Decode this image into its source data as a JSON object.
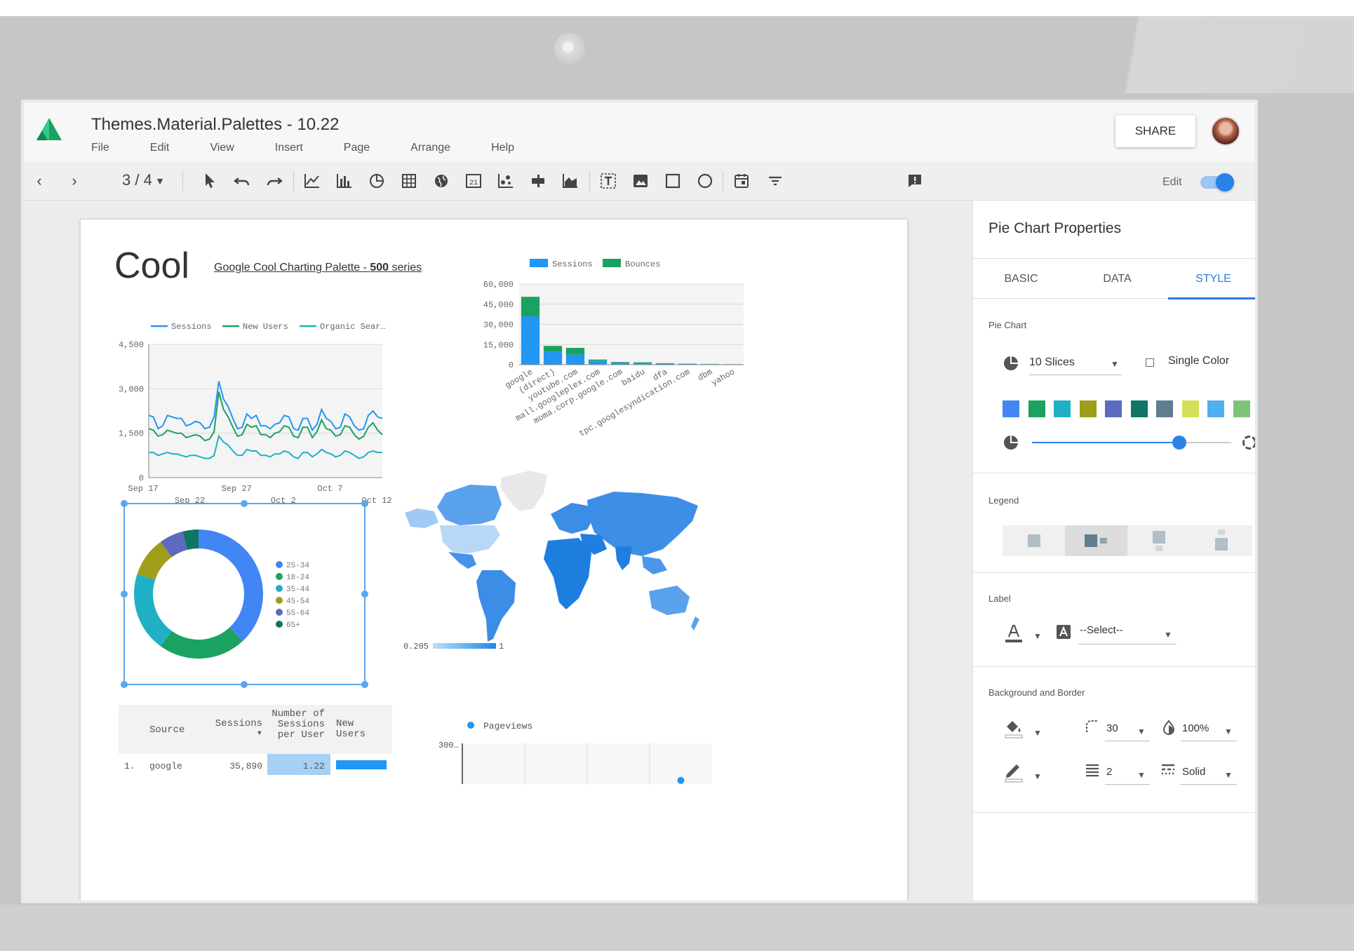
{
  "app": {
    "title": "Themes.Material.Palettes - 10.22",
    "menu": [
      "File",
      "Edit",
      "View",
      "Insert",
      "Page",
      "Arrange",
      "Help"
    ],
    "share_label": "SHARE",
    "page_indicator": "3 / 4",
    "edit_label": "Edit",
    "edit_mode_on": true
  },
  "report": {
    "heading": "Cool",
    "subtitle_prefix": "Google Cool Charting Palette - ",
    "subtitle_bold": "500",
    "subtitle_suffix": " series"
  },
  "chart_data": [
    {
      "type": "line",
      "series": [
        {
          "name": "Sessions",
          "color": "#2196f3",
          "values": [
            2100,
            2050,
            1650,
            1750,
            2100,
            2050,
            2000,
            2000,
            1750,
            1800,
            1900,
            1850,
            1650,
            1700,
            2050,
            3250,
            2650,
            2400,
            2000,
            1650,
            1700,
            2150,
            2000,
            2100,
            1750,
            1750,
            1650,
            1800,
            1850,
            2100,
            2050,
            1650,
            1600,
            2000,
            2000,
            1600,
            1800,
            2300,
            2000,
            1900,
            1650,
            1700,
            2150,
            2050,
            1750,
            1600,
            1650,
            2100,
            2250,
            2050,
            2000
          ]
        },
        {
          "name": "New Users",
          "color": "#1aa260",
          "values": [
            1650,
            1600,
            1400,
            1450,
            1600,
            1550,
            1500,
            1500,
            1350,
            1400,
            1450,
            1400,
            1250,
            1300,
            1550,
            2900,
            2300,
            2050,
            1700,
            1400,
            1450,
            1800,
            1700,
            1750,
            1450,
            1450,
            1350,
            1500,
            1550,
            1750,
            1700,
            1400,
            1350,
            1700,
            1700,
            1350,
            1550,
            1950,
            1650,
            1600,
            1400,
            1450,
            1750,
            1700,
            1450,
            1300,
            1400,
            1700,
            1850,
            1600,
            1450
          ]
        },
        {
          "name": "Organic Sear…",
          "color": "#1fb0c6",
          "values": [
            850,
            850,
            750,
            800,
            850,
            800,
            800,
            750,
            700,
            750,
            750,
            700,
            650,
            650,
            750,
            1400,
            1200,
            1100,
            900,
            750,
            750,
            950,
            900,
            900,
            750,
            750,
            700,
            800,
            800,
            900,
            850,
            700,
            650,
            850,
            850,
            700,
            800,
            950,
            850,
            800,
            700,
            750,
            900,
            850,
            750,
            650,
            700,
            850,
            900,
            850,
            850
          ]
        }
      ],
      "x_tick_labels_top": [
        "Sep 17",
        "Sep 27",
        "Oct 7"
      ],
      "x_tick_labels_bottom": [
        "Sep 22",
        "Oct 2",
        "Oct 12"
      ],
      "y_ticks": [
        "4,500",
        "3,000",
        "1,500",
        "0"
      ],
      "ylim": [
        0,
        4500
      ],
      "legend_position": "top",
      "grid": true
    },
    {
      "type": "bar",
      "stacked": true,
      "categories": [
        "google",
        "(direct)",
        "youtube.com",
        "mall.googleplex.com",
        "moma.corp.google.com",
        "baidu",
        "dfa",
        "tpc.googlesyndication.com",
        "dbm",
        "yahoo"
      ],
      "series": [
        {
          "name": "Sessions",
          "color": "#2196f3",
          "values": [
            36000,
            9500,
            7500,
            3000,
            1500,
            1200,
            800,
            600,
            400,
            300
          ]
        },
        {
          "name": "Bounces",
          "color": "#1aa260",
          "values": [
            14500,
            4500,
            5000,
            800,
            500,
            600,
            300,
            200,
            150,
            100
          ]
        }
      ],
      "y_ticks": [
        "60,000",
        "45,000",
        "30,000",
        "15,000",
        "0"
      ],
      "ylim": [
        0,
        60000
      ],
      "legend_position": "top",
      "grid": true
    },
    {
      "type": "pie",
      "donut": true,
      "labels": [
        "25-34",
        "18-24",
        "35-44",
        "45-54",
        "55-64",
        "65+"
      ],
      "values": [
        38,
        22,
        20,
        10,
        6,
        4
      ],
      "colors": [
        "#4285f4",
        "#1aa260",
        "#1fb0c6",
        "#9e9e1a",
        "#5c6bc0",
        "#0f7564"
      ],
      "legend_position": "right"
    },
    {
      "type": "other",
      "kind": "geo-map",
      "color_range": [
        "0.205",
        "1"
      ],
      "low_color": "#bbdefb",
      "high_color": "#1e88e5"
    },
    {
      "type": "table",
      "columns": [
        "Source",
        "Sessions ▾",
        "Number of Sessions per User",
        "New Users"
      ],
      "rows": [
        {
          "index": "1.",
          "source": "google",
          "sessions": "35,890",
          "sessions_per_user": "1.22",
          "new_users_bar": 0.9
        }
      ]
    },
    {
      "type": "scatter",
      "series": [
        {
          "name": "Pageviews",
          "color": "#2196f3",
          "values": [
            [
              3.5,
              40
            ]
          ]
        }
      ],
      "y_ticks": [
        "300"
      ],
      "legend_position": "top"
    }
  ],
  "properties_panel": {
    "title": "Pie Chart Properties",
    "tabs": [
      "BASIC",
      "DATA",
      "STYLE"
    ],
    "active_tab": "STYLE",
    "sections": {
      "pie_chart": "Pie Chart",
      "legend": "Legend",
      "label": "Label",
      "background": "Background and Border"
    },
    "slices_value": "10 Slices",
    "single_color_label": "Single Color",
    "single_color_checked": false,
    "palette": [
      "#4285f4",
      "#1aa260",
      "#1fb0c6",
      "#9e9e1a",
      "#5c6bc0",
      "#0f7564",
      "#607d8b",
      "#d4e157",
      "#4fb0f0",
      "#7dc47a"
    ],
    "donut_slider": 0.74,
    "legend_selected_index": 1,
    "label_select": "--Select--",
    "corner_radius": "30",
    "opacity": "100%",
    "border_weight": "2",
    "border_style": "Solid"
  }
}
